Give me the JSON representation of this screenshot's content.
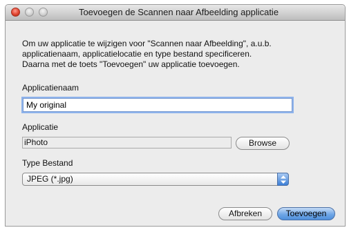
{
  "window": {
    "title": "Toevoegen de Scannen naar Afbeelding applicatie"
  },
  "description": {
    "line1": "Om uw applicatie te wijzigen voor \"Scannen naar Afbeelding\", a.u.b.",
    "line2": "applicatienaam, applicatielocatie en type bestand specificeren.",
    "line3": "Daarna met de toets \"Toevoegen\" uw applicatie toevoegen."
  },
  "app_name": {
    "label": "Applicatienaam",
    "value": "My original"
  },
  "application": {
    "label": "Applicatie",
    "value": "iPhoto",
    "browse_label": "Browse"
  },
  "file_type": {
    "label": "Type Bestand",
    "selected": "JPEG (*.jpg)"
  },
  "buttons": {
    "cancel_label": "Afbreken",
    "add_label": "Toevoegen"
  },
  "colors": {
    "accent": "#6fa6e6",
    "close_button": "#e0442f"
  },
  "icons": [
    "close-icon",
    "minimize-icon",
    "zoom-icon",
    "updown-arrows-icon"
  ]
}
